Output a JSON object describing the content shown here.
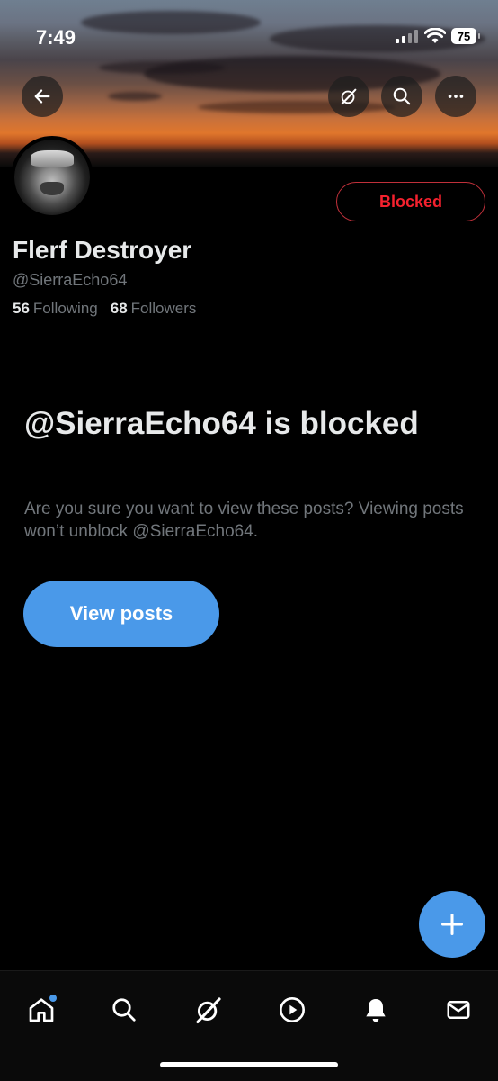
{
  "status_bar": {
    "time": "7:49",
    "battery": "75"
  },
  "profile": {
    "display_name": "Flerf Destroyer",
    "handle": "@SierraEcho64",
    "following_count": "56",
    "following_label": "Following",
    "followers_count": "68",
    "followers_label": "Followers",
    "blocked_button": "Blocked"
  },
  "blocked_notice": {
    "title": "@SierraEcho64 is blocked",
    "description": "Are you sure you want to view these posts? Viewing posts won’t unblock @SierraEcho64.",
    "view_button": "View posts"
  },
  "icons": {
    "header": [
      "back-arrow-icon",
      "grok-icon",
      "search-icon",
      "more-icon"
    ],
    "tabs": [
      "home-icon",
      "search-icon",
      "grok-icon",
      "video-icon",
      "notifications-icon",
      "messages-icon"
    ],
    "fab": "compose-plus-icon"
  },
  "colors": {
    "accent": "#4a99e9",
    "blocked_red": "#f4212e",
    "background": "#000000"
  }
}
